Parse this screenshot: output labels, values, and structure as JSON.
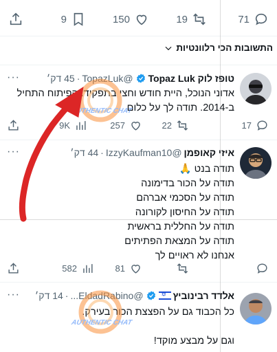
{
  "top_actions": {
    "replies": "71",
    "retweets": "19",
    "likes": "150",
    "bookmarks": "9"
  },
  "sort_label": "התשובות הכי רלוונטיות",
  "tweets": [
    {
      "name": "טופז לוק Topaz Luk",
      "handle": "@TopazLuk",
      "time": "45 דק׳",
      "verified": true,
      "lines": [
        "אדוני הנוכל, היית חודש וחצי בתפקיד. הפיתוח התחיל",
        "ב-2014. תודה לך על כלום"
      ],
      "actions": {
        "replies": "17",
        "retweets": "22",
        "likes": "257",
        "views": "9K"
      }
    },
    {
      "name": "איזי קאופמן",
      "handle": "@IzzyKaufman10",
      "time": "44 דק׳",
      "verified": false,
      "lines": [
        "תודה בנט 🙏",
        "תודה על הכור בדימונה",
        "תודה על הסכמי אברהם",
        "תודה על החיסון לקורונה",
        "תודה על החללית בראשית",
        "תודה על המצאת הפתיתים",
        "אנחנו לא ראויים לך"
      ],
      "actions": {
        "replies": "",
        "retweets": "",
        "likes": "81",
        "views": "582"
      }
    },
    {
      "name": "אלדד רבינוביץ",
      "handle": "@EldadRabino...",
      "time": "14 דק׳",
      "verified": true,
      "lines": [
        "כל הכבוד גם על הפצצת הכור בעירק.",
        "",
        "וגם על מבצע מוקד!"
      ],
      "actions": {}
    }
  ],
  "watermark_text": "AUTHENTIC CHAT",
  "colors": {
    "muted": "#536471",
    "verified": "#1d9bf0",
    "arrow": "#dc2626",
    "text": "#0f1419"
  }
}
